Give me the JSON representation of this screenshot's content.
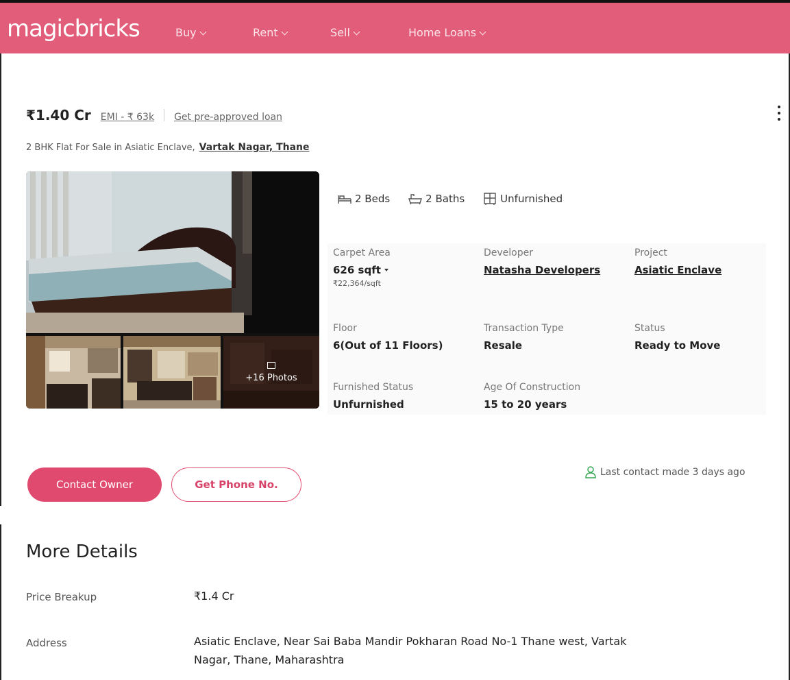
{
  "nav": {
    "logo": "magicbricks",
    "items": [
      {
        "label": "Buy"
      },
      {
        "label": "Rent"
      },
      {
        "label": "Sell"
      },
      {
        "label": "Home Loans"
      }
    ]
  },
  "listing": {
    "price": "₹1.40 Cr",
    "emi": "EMI - ₹ 63k",
    "loan_link": "Get pre-approved loan",
    "title": "2 BHK Flat For Sale in Asiatic Enclave,",
    "location": "Vartak Nagar, Thane",
    "photos_label": "+16 Photos",
    "features": {
      "beds": "2 Beds",
      "baths": "2 Baths",
      "furnishing": "Unfurnished"
    },
    "specs": {
      "carpet_area_label": "Carpet Area",
      "carpet_area_value": "626 sqft",
      "carpet_area_rate": "₹22,364/sqft",
      "developer_label": "Developer",
      "developer_value": "Natasha Developers",
      "project_label": "Project",
      "project_value": "Asiatic Enclave",
      "floor_label": "Floor",
      "floor_value": "6(Out of 11 Floors)",
      "transaction_label": "Transaction Type",
      "transaction_value": "Resale",
      "status_label": "Status",
      "status_value": "Ready to Move",
      "furnished_label": "Furnished Status",
      "furnished_value": "Unfurnished",
      "age_label": "Age Of Construction",
      "age_value": "15 to 20 years"
    }
  },
  "actions": {
    "contact_owner": "Contact Owner",
    "get_phone": "Get Phone No.",
    "last_contact": "Last contact made 3 days ago"
  },
  "more_details": {
    "title": "More Details",
    "price_breakup_label": "Price Breakup",
    "price_breakup_value": "₹1.4 Cr",
    "address_label": "Address",
    "address_line1": "Asiatic Enclave, Near Sai Baba Mandir Pokharan Road No-1 Thane west, Vartak",
    "address_line2": "Nagar, Thane, Maharashtra"
  },
  "colors": {
    "brand": "#e25d79",
    "button": "#e04a6e",
    "success_icon": "#3aa757"
  }
}
